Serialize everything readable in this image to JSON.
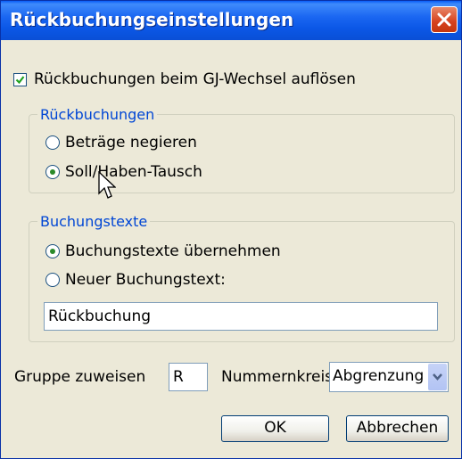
{
  "window": {
    "title": "Rückbuchungseinstellungen"
  },
  "icons": {
    "close": "close-icon",
    "checkbox": "check-icon",
    "dropdown": "chevron-down-icon",
    "cursor": "mouse-pointer-icon"
  },
  "checkbox": {
    "label": "Rückbuchungen beim GJ-Wechsel auflösen",
    "checked": true
  },
  "group_rueckbuchungen": {
    "title": "Rückbuchungen",
    "options": [
      {
        "label": "Beträge negieren",
        "selected": false
      },
      {
        "label": "Soll/Haben-Tausch",
        "selected": true
      }
    ]
  },
  "group_buchungstexte": {
    "title": "Buchungstexte",
    "options": [
      {
        "label": "Buchungstexte übernehmen",
        "selected": true
      },
      {
        "label": "Neuer Buchungstext:",
        "selected": false
      }
    ],
    "text_value": "Rückbuchung"
  },
  "gruppe": {
    "label": "Gruppe zuweisen",
    "value": "R"
  },
  "nummernkreis": {
    "label": "Nummernkreis",
    "value": "Abgrenzung"
  },
  "buttons": {
    "ok": "OK",
    "cancel": "Abbrechen"
  },
  "colors": {
    "title_bar": "#0b57e6",
    "window_bg": "#ece9d8",
    "group_title": "#0046d5",
    "close_button": "#d6411d",
    "radio_dot": "#2a8a2a"
  }
}
